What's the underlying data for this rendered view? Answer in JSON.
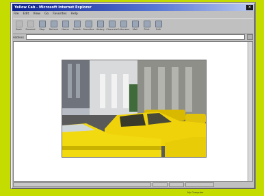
{
  "window": {
    "title": "Yellow Cab - Microsoft Internet Explorer",
    "close_glyph": "×"
  },
  "menu": [
    "File",
    "Edit",
    "View",
    "Go",
    "Favorites",
    "Help"
  ],
  "toolbar": [
    {
      "label": "Back",
      "icon": "back-icon",
      "disabled": true
    },
    {
      "label": "Forward",
      "icon": "forward-icon",
      "disabled": true
    },
    {
      "label": "Stop",
      "icon": "stop-icon",
      "disabled": false
    },
    {
      "label": "Refresh",
      "icon": "refresh-icon",
      "disabled": false
    },
    {
      "label": "Home",
      "icon": "home-icon",
      "disabled": false
    },
    {
      "label": "Search",
      "icon": "search-icon",
      "disabled": false
    },
    {
      "label": "Favorites",
      "icon": "favorites-icon",
      "disabled": false
    },
    {
      "label": "History",
      "icon": "history-icon",
      "disabled": false
    },
    {
      "label": "Channels",
      "icon": "channels-icon",
      "disabled": false
    },
    {
      "label": "Fullscreen",
      "icon": "fullscreen-icon",
      "disabled": false
    },
    {
      "label": "Mail",
      "icon": "mail-icon",
      "disabled": false
    },
    {
      "label": "Print",
      "icon": "print-icon",
      "disabled": false
    },
    {
      "label": "Edit",
      "icon": "edit-icon",
      "disabled": false
    }
  ],
  "address": {
    "label": "Address",
    "value": ""
  },
  "content": {
    "image_alt": "Yellow taxi cabs in city traffic"
  },
  "status": {
    "zone": "My Computer"
  },
  "colors": {
    "background": "#c4dc00",
    "window": "#c0c0c0",
    "titlebar": "#0a1f8c",
    "taxi": "#f0d20a"
  }
}
